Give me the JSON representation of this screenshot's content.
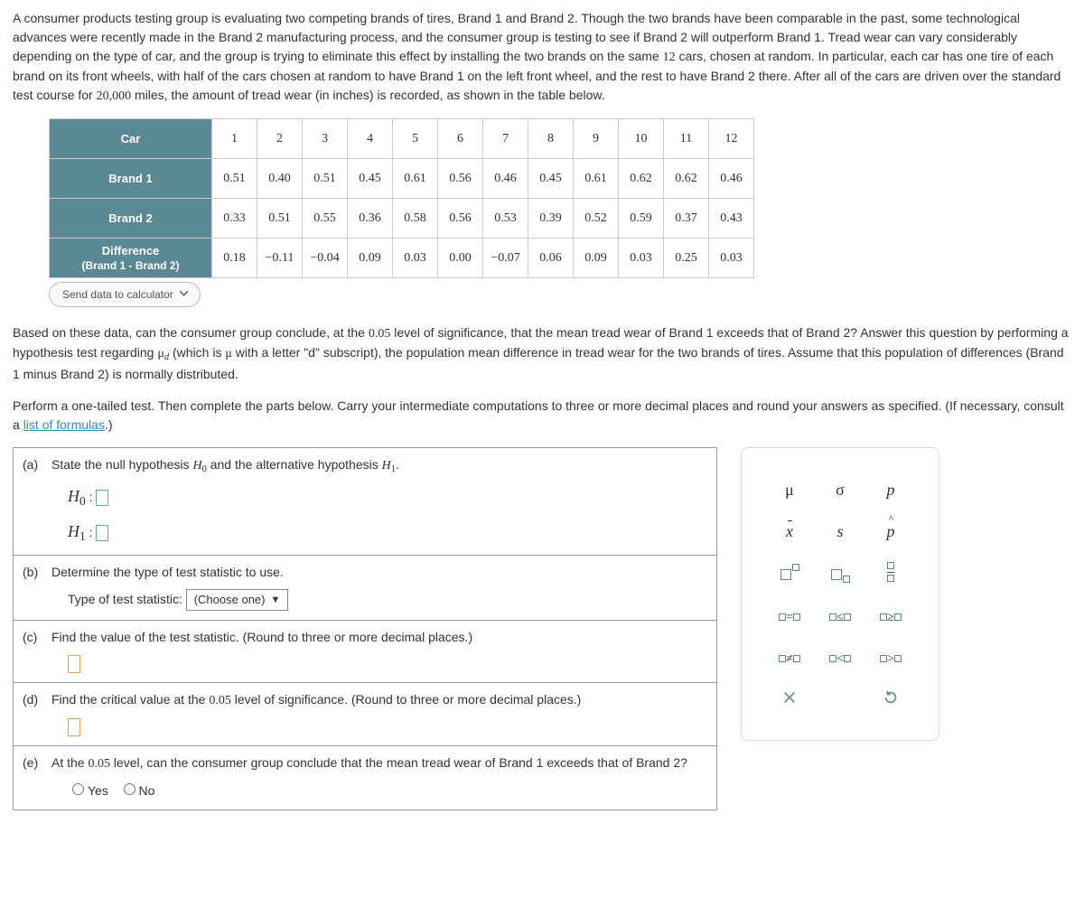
{
  "intro": {
    "p1a": "A consumer products testing group is evaluating two competing brands of tires, Brand 1 and Brand 2. Though the two brands have been comparable in the past, some technological advances were recently made in the Brand 2 manufacturing process, and the consumer group is testing to see if Brand 2 will outperform Brand 1. Tread wear can vary considerably depending on the type of car, and the group is trying to eliminate this effect by installing the two brands on the same ",
    "ncars": "12",
    "p1b": " cars, chosen at random. In particular, each car has one tire of each brand on its front wheels, with half of the cars chosen at random to have Brand 1 on the left front wheel, and the rest to have Brand 2 there. After all of the cars are driven over the standard test course for ",
    "miles": "20,000",
    "p1c": " miles, the amount of tread wear (in inches) is recorded, as shown in the table below."
  },
  "table": {
    "row_headers": [
      "Car",
      "Brand 1",
      "Brand 2"
    ],
    "diff_header_line1": "Difference",
    "diff_header_line2": "(Brand 1 - Brand 2)",
    "cols": [
      "1",
      "2",
      "3",
      "4",
      "5",
      "6",
      "7",
      "8",
      "9",
      "10",
      "11",
      "12"
    ],
    "brand1": [
      "0.51",
      "0.40",
      "0.51",
      "0.45",
      "0.61",
      "0.56",
      "0.46",
      "0.45",
      "0.61",
      "0.62",
      "0.62",
      "0.46"
    ],
    "brand2": [
      "0.33",
      "0.51",
      "0.55",
      "0.36",
      "0.58",
      "0.56",
      "0.53",
      "0.39",
      "0.52",
      "0.59",
      "0.37",
      "0.43"
    ],
    "diff": [
      "0.18",
      "−0.11",
      "−0.04",
      "0.09",
      "0.03",
      "0.00",
      "−0.07",
      "0.06",
      "0.09",
      "0.03",
      "0.25",
      "0.03"
    ]
  },
  "send_button": "Send data to calculator",
  "mid": {
    "p2a": "Based on these data, can the consumer group conclude, at the ",
    "alpha": "0.05",
    "p2b": " level of significance, that the mean tread wear of Brand 1 exceeds that of Brand 2? Answer this question by performing a hypothesis test regarding ",
    "mu_d": "μ",
    "mu_d_sub": "d",
    "p2c": " (which is ",
    "mu": "μ",
    "p2d": " with a letter \"d\" subscript), the population mean difference in tread wear for the two brands of tires. Assume that this population of differences (Brand 1 minus Brand 2) is normally distributed.",
    "p3a": "Perform a one-tailed test. Then complete the parts below. Carry your intermediate computations to three or more decimal places and round your answers as specified. (If necessary, consult a ",
    "link": "list of formulas",
    "p3b": ".)"
  },
  "q": {
    "a": {
      "letter": "(a)",
      "text_pre": "State the null hypothesis ",
      "H0": "H",
      "H0s": "0",
      "text_mid": " and the alternative hypothesis ",
      "H1": "H",
      "H1s": "1",
      "text_post": ".",
      "H0_label": "H",
      "H0_label_s": "0",
      "colon": " :",
      "H1_label": "H",
      "H1_label_s": "1"
    },
    "b": {
      "letter": "(b)",
      "text": "Determine the type of test statistic to use.",
      "label": "Type of test statistic:",
      "choose": "(Choose one)"
    },
    "c": {
      "letter": "(c)",
      "text": "Find the value of the test statistic. (Round to three or more decimal places.)"
    },
    "d": {
      "letter": "(d)",
      "text_pre": "Find the critical value at the ",
      "alpha": "0.05",
      "text_post": " level of significance. (Round to three or more decimal places.)"
    },
    "e": {
      "letter": "(e)",
      "text_pre": "At the ",
      "alpha": "0.05",
      "text_post": " level, can the consumer group conclude that the mean tread wear of Brand 1 exceeds that of Brand 2?",
      "yes": "Yes",
      "no": "No"
    }
  },
  "palette": {
    "r1": [
      "μ",
      "σ",
      "p"
    ],
    "r2": [
      "x̄",
      "s",
      "p̂"
    ],
    "r4": [
      "□=□",
      "□≤□",
      "□≥□"
    ],
    "r5": [
      "□≠□",
      "□<□",
      "□>□"
    ]
  }
}
